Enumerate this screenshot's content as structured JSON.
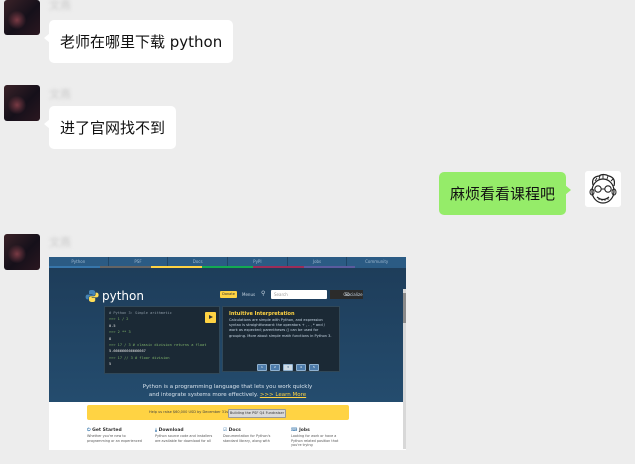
{
  "messages": [
    {
      "sender": "文燕",
      "text": "老师在哪里下载 python"
    },
    {
      "sender": "文燕",
      "text": "进了官网找不到"
    },
    {
      "text": "麻烦看看课程吧"
    },
    {
      "sender": "文燕"
    }
  ],
  "screenshot": {
    "tabs": [
      "Python",
      "PSF",
      "Docs",
      "PyPI",
      "Jobs",
      "Community"
    ],
    "logo_text": "python",
    "donate": "Donate",
    "nav_small": [
      "Menus",
      "AA",
      "Socialize"
    ],
    "search_placeholder": "Search",
    "go": "GO",
    "code_lines": [
      "# Python 3: Simple arithmetic",
      ">>> 1 / 2",
      "0.5",
      ">>> 2 ** 3",
      "8",
      ">>> 17 / 3  # classic division returns a float",
      "5.666666666666667",
      ">>> 17 // 3  # floor division",
      "5"
    ],
    "info_title": "Intuitive Interpretation",
    "info_text": "Calculations are simple with Python, and expression syntax is straightforward: the operators + , - , * and / work as expected; parentheses () can be used for grouping. More about simple math functions in Python 3.",
    "dots": [
      "1",
      "2",
      "3",
      "4",
      "5"
    ],
    "tagline_1": "Python is a programming language that lets you work quickly",
    "tagline_2": "and integrate systems more effectively.",
    "learn_more": ">>> Learn More",
    "fund_text": "Help us raise $60,000 USD by December 31st!",
    "fund_button": "Building the PSF Q4 Fundraiser",
    "features": [
      {
        "icon": "⏻",
        "title": "Get Started",
        "text": "Whether you're new to programming or an experienced"
      },
      {
        "icon": "⤓",
        "title": "Download",
        "text": "Python source code and installers are available for download for all"
      },
      {
        "icon": "☑",
        "title": "Docs",
        "text": "Documentation for Python's standard library, along with"
      },
      {
        "icon": "⌨",
        "title": "Jobs",
        "text": "Looking for work or have a Python related position that you're trying"
      }
    ],
    "strip_colors": [
      "#3776ab",
      "#646464",
      "#ffd343",
      "#13aa52",
      "#9b2d59",
      "#5b5b9e",
      "#2b5b84"
    ]
  }
}
